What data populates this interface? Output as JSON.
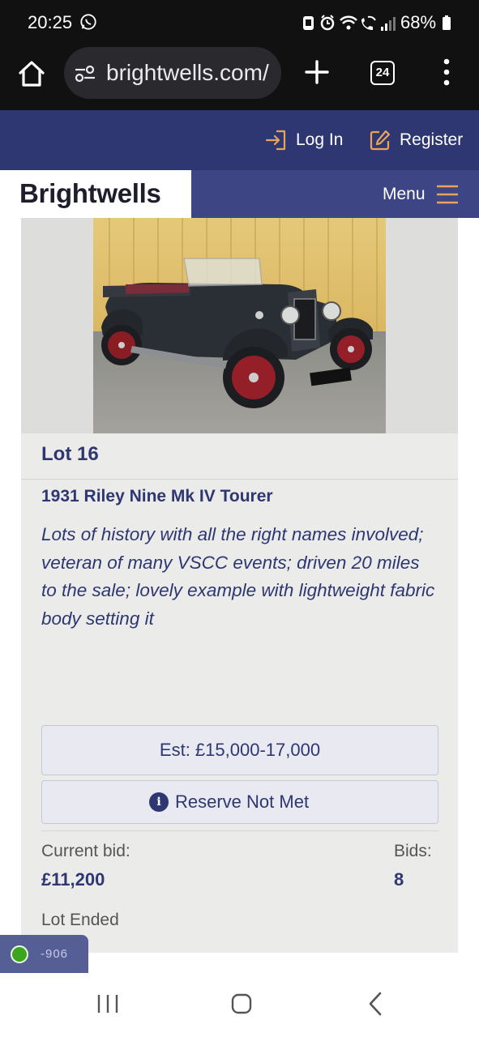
{
  "status_bar": {
    "time": "20:25",
    "battery": "68%",
    "icons": [
      "whatsapp-icon",
      "alarm-icon",
      "wifi-icon",
      "wifi-calling-icon",
      "signal-icon",
      "battery-icon"
    ]
  },
  "browser": {
    "url": "brightwells.com/",
    "tab_count": "24"
  },
  "site_header": {
    "login_label": "Log In",
    "register_label": "Register",
    "logo": "Brightwells",
    "menu_label": "Menu"
  },
  "lot": {
    "number": "Lot 16",
    "title": "1931 Riley Nine Mk IV Tourer",
    "description": "Lots of history with all the right names involved; veteran of many VSCC events; driven 20 miles to the sale; lovely example with lightweight fabric body setting it",
    "estimate": "Est: £15,000-17,000",
    "reserve_status": "Reserve Not Met",
    "current_bid_label": "Current bid:",
    "current_bid_value": "£11,200",
    "bids_label": "Bids:",
    "bids_value": "8",
    "status": "Lot Ended"
  },
  "badge": {
    "text": "-906"
  },
  "colors": {
    "brand_navy": "#2e3771",
    "nav_purple": "#3e4585",
    "accent_orange": "#e8a45a",
    "card_bg": "#ebebea"
  }
}
